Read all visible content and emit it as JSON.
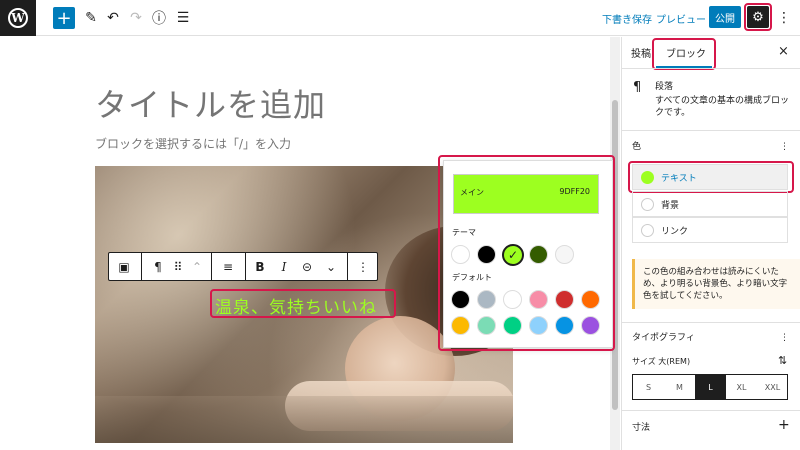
{
  "toolbar": {
    "logo": "W",
    "add_icon": "+",
    "pencil_icon": "✎",
    "undo_icon": "↶",
    "redo_icon": "↷",
    "info_icon": "ⓘ",
    "list_icon": "☰",
    "save_draft": "下書き保存",
    "preview": "プレビュー",
    "publish": "公開",
    "settings_icon": "⚙",
    "more_icon": "⋮"
  },
  "editor": {
    "title_placeholder": "タイトルを追加",
    "block_hint": "ブロックを選択するには「/」を入力",
    "cover_text": "温泉、気持ちいいね"
  },
  "block_toolbar": {
    "block_icon": "▣",
    "paragraph_icon": "¶",
    "drag_icon": "⠿",
    "move_icon": "⌃",
    "align_icon": "≡",
    "bold": "B",
    "italic": "I",
    "link_icon": "⊝",
    "chevron_icon": "⌄",
    "more_icon": "⋮"
  },
  "color_popover": {
    "main_name": "メイン",
    "main_hex": "9DFF20",
    "theme_label": "テーマ",
    "default_label": "デフォルト",
    "check_icon": "✓",
    "theme_colors": [
      "#ffffff",
      "#000000",
      "#9dff20",
      "#345c00",
      "#f6f6f6"
    ],
    "default_colors_row1": [
      "#000000",
      "#abb8c3",
      "#ffffff",
      "#f78da7",
      "#cf2e2e",
      "#ff6900"
    ],
    "default_colors_row2": [
      "#fcb900",
      "#7bdcb5",
      "#00d084",
      "#8ed1fc",
      "#0693e3",
      "#9b51e0"
    ]
  },
  "sidebar": {
    "tab_post": "投稿",
    "tab_block": "ブロック",
    "close_icon": "×",
    "block_icon": "¶",
    "block_name": "段落",
    "block_desc": "すべての文章の基本の構成ブロックです。",
    "color_section": "色",
    "section_more": "⋮",
    "color_text": "テキスト",
    "color_background": "背景",
    "color_link": "リンク",
    "notice": "この色の組み合わせは読みにくいため、より明るい背景色、より暗い文字色を試してください。",
    "typography": "タイポグラフィ",
    "size_label": "サイズ 大(REM)",
    "size_adjust_icon": "⇅",
    "sizes": [
      "S",
      "M",
      "L",
      "XL",
      "XXL"
    ],
    "size_active": "L",
    "dimensions": "寸法",
    "plus_icon": "+"
  },
  "accent_color": "#9dff20",
  "highlight_color": "#d6174a"
}
